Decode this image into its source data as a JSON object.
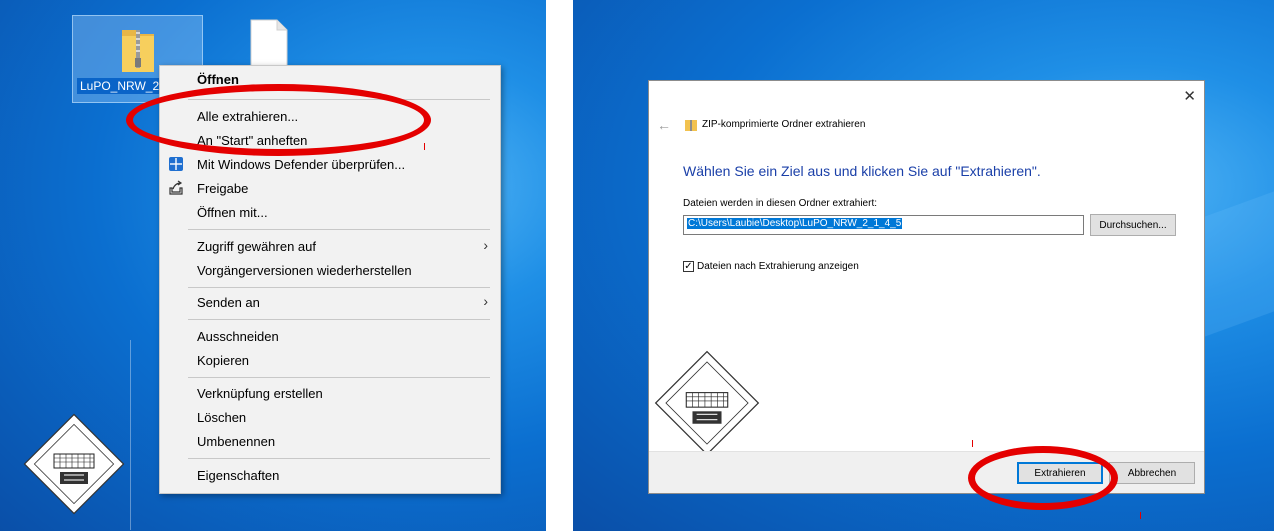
{
  "desktop_left": {
    "zip_file_label": "LuPO_NRW_2",
    "context_menu": {
      "items": [
        {
          "label": "Öffnen",
          "bold": true
        },
        {
          "label": "Alle extrahieren..."
        },
        {
          "label": "An \"Start\" anheften"
        },
        {
          "label": "Mit Windows Defender überprüfen..."
        },
        {
          "label": "Freigabe"
        },
        {
          "label": "Öffnen mit..."
        },
        {
          "label": "Zugriff gewähren auf"
        },
        {
          "label": "Vorgängerversionen wiederherstellen"
        },
        {
          "label": "Senden an"
        },
        {
          "label": "Ausschneiden"
        },
        {
          "label": "Kopieren"
        },
        {
          "label": "Verknüpfung erstellen"
        },
        {
          "label": "Löschen"
        },
        {
          "label": "Umbenennen"
        },
        {
          "label": "Eigenschaften"
        }
      ]
    }
  },
  "dialog": {
    "title": "ZIP-komprimierte Ordner extrahieren",
    "heading": "Wählen Sie ein Ziel aus und klicken Sie auf \"Extrahieren\".",
    "destination_label": "Dateien werden in diesen Ordner extrahiert:",
    "destination_path": "C:\\Users\\Laubie\\Desktop\\LuPO_NRW_2_1_4_5",
    "browse_label": "Durchsuchen...",
    "show_files_label": "Dateien nach Extrahierung anzeigen",
    "show_files_checked": true,
    "extract_label": "Extrahieren",
    "cancel_label": "Abbrechen",
    "close_glyph": "✕",
    "back_glyph": "←"
  },
  "colors": {
    "highlight_red": "#e40000",
    "accent_blue": "#0078d7",
    "heading_blue": "#1a3fa8"
  },
  "icons": {
    "zip_folder": "zip-folder-icon",
    "blank_file": "blank-file-icon",
    "defender": "windows-defender-icon",
    "share": "share-icon",
    "submenu_arrow": "chevron-right-icon"
  }
}
